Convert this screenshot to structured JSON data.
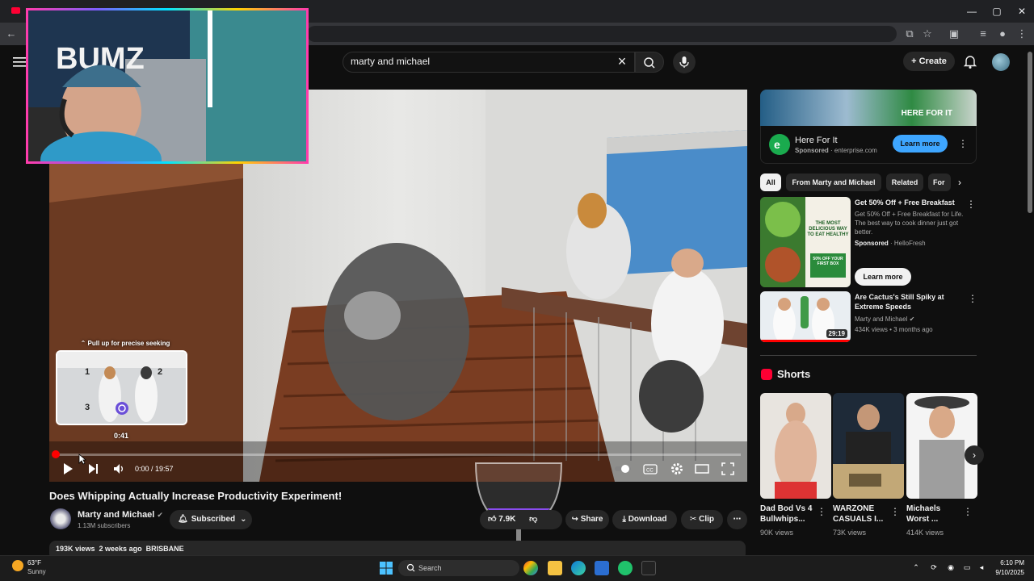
{
  "browser": {
    "window_controls": {
      "minimize": "—",
      "maximize": "▢",
      "close": "✕"
    }
  },
  "header": {
    "search_query": "marty and michael",
    "create_label": "Create"
  },
  "player": {
    "seek_hint": "⌃ Pull up for precise seeking",
    "preview_time": "0:41",
    "time_display": "0:00 / 19:57",
    "progress_fraction": 0.0,
    "webcam_sign": "BUMZ",
    "preview_labels": [
      "1",
      "2",
      "3"
    ]
  },
  "video": {
    "title": "Does Whipping Actually Increase Productivity Experiment!",
    "channel_name": "Marty and Michael",
    "subscribers": "1.13M subscribers",
    "subscribed_label": "Subscribed",
    "like_count": "7.9K",
    "share_label": "Share",
    "download_label": "Download",
    "clip_label": "Clip",
    "description_line": "193K views  2 weeks ago  BRISBANE"
  },
  "ad": {
    "banner_text": "HERE FOR IT",
    "title": "Here For It",
    "sponsored": "Sponsored",
    "domain": "enterprise.com",
    "learn_more": "Learn more"
  },
  "chips": [
    "All",
    "From Marty and Michael",
    "Related",
    "For"
  ],
  "recommendations": [
    {
      "title": "Get 50% Off + Free Breakfast",
      "description": "Get 50% Off + Free Breakfast for Life. The best way to cook dinner just got better.",
      "sponsored": "Sponsored",
      "advertiser": "HelloFresh",
      "learn_more": "Learn more",
      "thumb_text": "THE MOST DELICIOUS WAY TO EAT HEALTHY",
      "thumb_badge": "50% OFF YOUR FIRST BOX"
    },
    {
      "title": "Are Cactus's Still Spiky at Extreme Speeds",
      "channel": "Marty and Michael",
      "meta": "434K views • 3 months ago",
      "duration": "29:19"
    }
  ],
  "shorts": {
    "heading": "Shorts",
    "items": [
      {
        "title": "Dad Bod Vs 4 Bullwhips...",
        "views": "90K views"
      },
      {
        "title": "WARZONE CASUALS I...",
        "views": "73K views"
      },
      {
        "title": "Michaels Worst ...",
        "views": "414K views"
      }
    ]
  },
  "taskbar": {
    "temperature": "63°F",
    "weather": "Sunny",
    "search_label": "Search",
    "time": "6:10 PM",
    "date": "9/10/2025"
  },
  "colors": {
    "youtube_red": "#ff0033",
    "accent_blue": "#3ea6ff",
    "background": "#0f0f0f",
    "chip_bg": "#272727"
  }
}
